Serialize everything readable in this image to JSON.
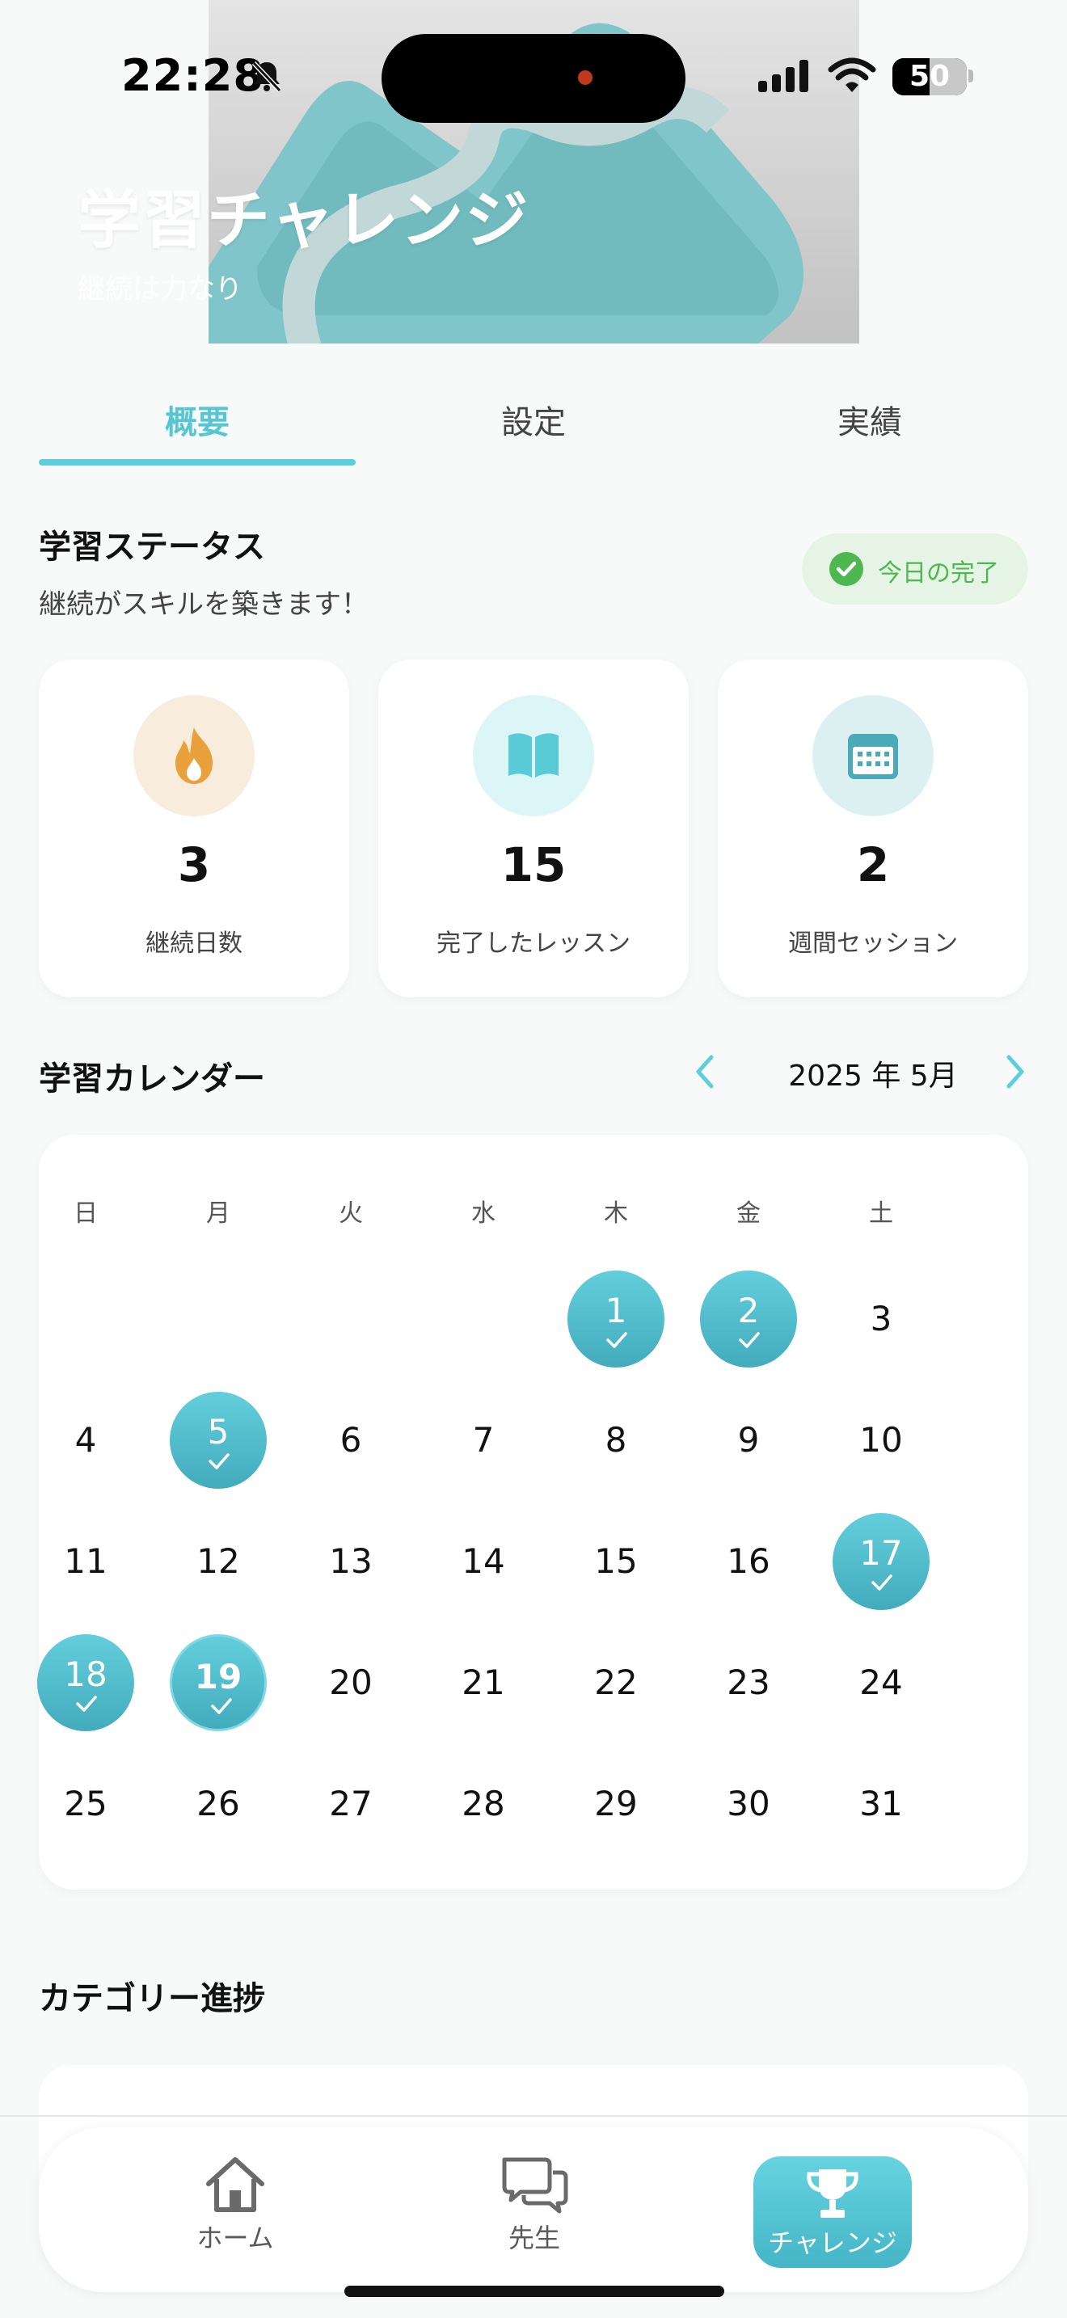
{
  "status_bar": {
    "time": "22:28",
    "battery": "50"
  },
  "hero": {
    "title": "学習チャレンジ",
    "subtitle": "継続は力なり"
  },
  "tabs": [
    {
      "label": "概要",
      "active": true
    },
    {
      "label": "設定",
      "active": false
    },
    {
      "label": "実績",
      "active": false
    }
  ],
  "status_section": {
    "title": "学習ステータス",
    "subtitle": "継続がスキルを築きます！",
    "badge": "今日の完了"
  },
  "stats": [
    {
      "icon": "flame-icon",
      "value": "3",
      "label": "継続日数",
      "color": "#e9a23b"
    },
    {
      "icon": "book-icon",
      "value": "15",
      "label": "完了したレッスン",
      "color": "#59cbd7"
    },
    {
      "icon": "calendar-icon",
      "value": "2",
      "label": "週間セッション",
      "color": "#4aaab8"
    }
  ],
  "calendar": {
    "title": "学習カレンダー",
    "month_label": "2025 年 5月",
    "weekdays": [
      "日",
      "月",
      "火",
      "水",
      "木",
      "金",
      "土"
    ],
    "first_weekday_index": 4,
    "days_in_month": 31,
    "completed_days": [
      1,
      2,
      5,
      17,
      18,
      19
    ],
    "today": 19
  },
  "category_section": {
    "title": "カテゴリー進捗"
  },
  "bottom_nav": [
    {
      "icon": "home-icon",
      "label": "ホーム",
      "active": false
    },
    {
      "icon": "chat-icon",
      "label": "先生",
      "active": false
    },
    {
      "icon": "trophy-icon",
      "label": "チャレンジ",
      "active": true
    }
  ],
  "colors": {
    "accent": "#5ccfda",
    "success": "#4cb84f"
  }
}
